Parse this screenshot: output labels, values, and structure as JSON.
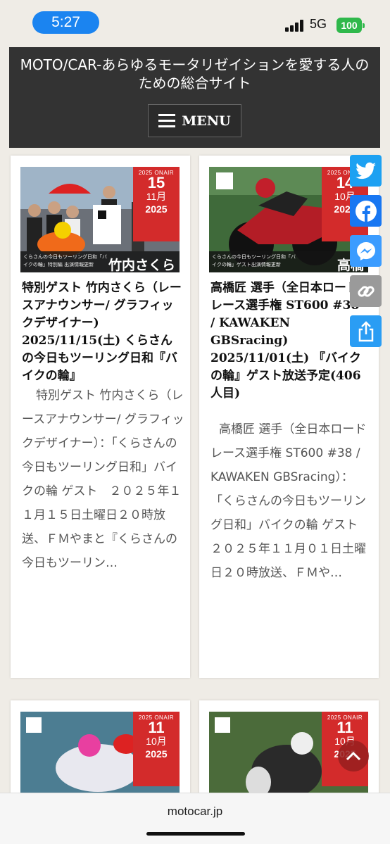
{
  "status_bar": {
    "time": "5:27",
    "network": "5G",
    "battery": "100"
  },
  "header": {
    "site_title": "MOTO/CAR-あらゆるモータリゼイションを愛する人のための総合サイト",
    "menu_label": "MENU"
  },
  "posts": [
    {
      "badge": {
        "onair": "2025 ONAIR",
        "day": "15",
        "month": "11月",
        "year": "2025"
      },
      "image_caption": "くらさんの今日もツーリング日和「バイクの輪」特別編 出演情報更新",
      "image_name": "竹内さくら",
      "title": "特別ゲスト 竹内さくら（レースアナウンサー/ グラフィックデザイナー) 2025/11/15(土) くらさんの今日もツーリング日和『バイクの輪』",
      "excerpt": "特別ゲスト 竹内さくら（レースアナウンサー/ グラフィックデザイナー）：「くらさんの今日もツーリング日和」バイクの輪 ゲスト　２０２５年１１月１５日土曜日２０時放送、ＦＭやまと『くらさんの今日もツーリン…"
    },
    {
      "badge": {
        "onair": "2025 ONAIR",
        "day": "14",
        "month": "10月",
        "year": "2025"
      },
      "image_caption": "くらさんの今日もツーリング日和「バイクの輪」ゲスト出演情報更新",
      "image_name": "高橋",
      "title": "高橋匠 選手（全日本ロードレース選手権 ST600 #38 / KAWAKEN GBSracing) 2025/11/01(土) 『バイクの輪』ゲスト放送予定(406人目)",
      "excerpt": "高橋匠 選手（全日本ロードレース選手権 ST600 #38 / KAWAKEN GBSracing）：「くらさんの今日もツーリング日和」バイクの輪 ゲスト　２０２５年１１月０１日土曜日２０時放送、ＦＭや…"
    },
    {
      "badge": {
        "onair": "2025 ONAIR",
        "day": "11",
        "month": "10月",
        "year": "2025"
      }
    },
    {
      "badge": {
        "onair": "2025 ONAIR",
        "day": "11",
        "month": "10月",
        "year": "2025"
      }
    }
  ],
  "share": [
    {
      "name": "Twitter",
      "color": "#1da1f2"
    },
    {
      "name": "Facebook",
      "color": "#1877f2"
    },
    {
      "name": "Messenger",
      "color": "#3b9cff"
    },
    {
      "name": "Copy Link",
      "color": "#9a9a9a"
    },
    {
      "name": "Share",
      "color": "#2a9df4"
    }
  ],
  "browser": {
    "url": "motocar.jp"
  }
}
